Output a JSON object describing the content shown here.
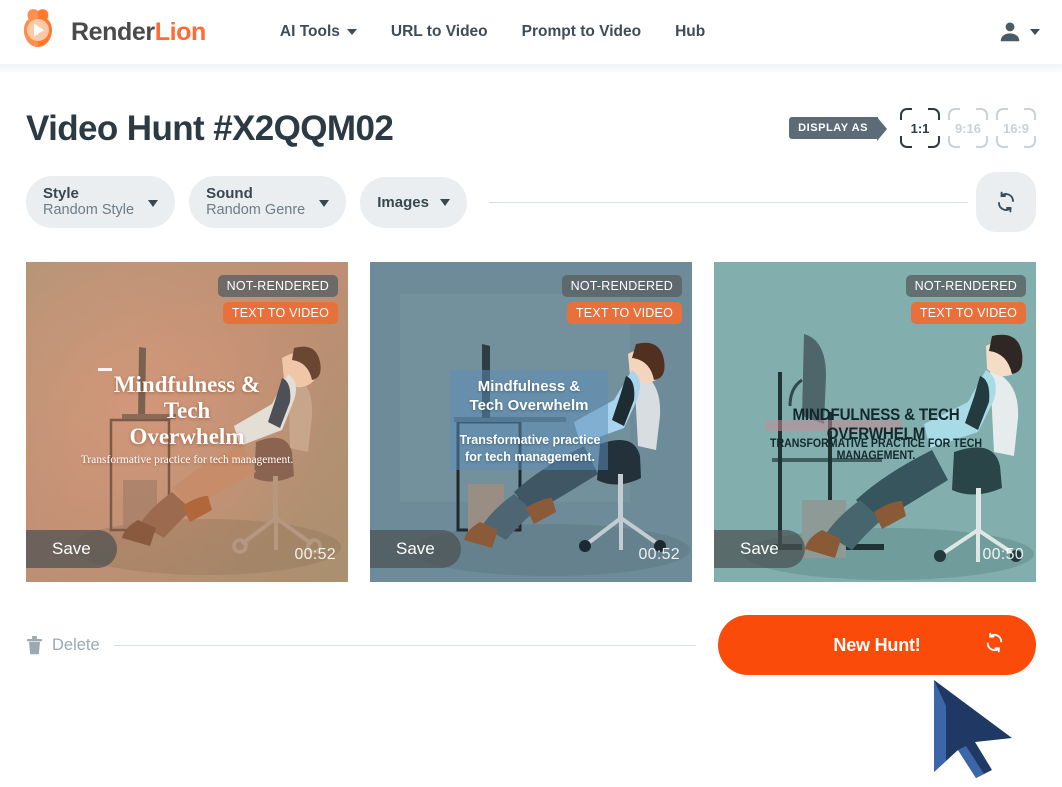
{
  "header": {
    "logo": {
      "icon": "lion-play-logo-icon",
      "text_primary": "Render",
      "text_secondary": "Lion"
    },
    "nav": [
      {
        "label": "AI Tools",
        "has_caret": true
      },
      {
        "label": "URL to Video",
        "has_caret": false
      },
      {
        "label": "Prompt to Video",
        "has_caret": false
      },
      {
        "label": "Hub",
        "has_caret": false
      }
    ],
    "account": {
      "icon": "user-account-icon",
      "has_caret": true
    }
  },
  "page": {
    "title": "Video Hunt #X2QQM02",
    "display_as": {
      "label": "DISPLAY AS",
      "options": [
        {
          "label": "1:1",
          "active": true
        },
        {
          "label": "9:16",
          "active": false
        },
        {
          "label": "16:9",
          "active": false
        }
      ]
    },
    "filters": [
      {
        "label": "Style",
        "value": "Random Style",
        "type": "two-line"
      },
      {
        "label": "Sound",
        "value": "Random Genre",
        "type": "two-line"
      },
      {
        "label": "Images",
        "value": "",
        "type": "single"
      }
    ],
    "refresh": {
      "icon": "refresh-sync-icon"
    }
  },
  "cards": [
    {
      "status_badge": "NOT-RENDERED",
      "type_badge": "TEXT TO VIDEO",
      "save_label": "Save",
      "duration": "00:52",
      "overlay_title": "Mindfulness &\nTech\nOverwhelm",
      "overlay_title_lines": [
        "Mindfulness &",
        "Tech",
        "Overwhelm"
      ],
      "overlay_subtitle": "Transformative practice for tech management.",
      "theme_color": "#b08a70"
    },
    {
      "status_badge": "NOT-RENDERED",
      "type_badge": "TEXT TO VIDEO",
      "save_label": "Save",
      "duration": "00:52",
      "overlay_title_lines": [
        "Mindfulness &",
        "Tech Overwhelm"
      ],
      "overlay_subtitle_lines": [
        "Transformative practice",
        "for tech management."
      ],
      "theme_color": "#6d8b99"
    },
    {
      "status_badge": "NOT-RENDERED",
      "type_badge": "TEXT TO VIDEO",
      "save_label": "Save",
      "duration": "00:50",
      "overlay_title": "MINDFULNESS & TECH OVERWHELM",
      "overlay_subtitle": "TRANSFORMATIVE PRACTICE FOR TECH MANAGEMENT.",
      "theme_color": "#82afae"
    }
  ],
  "bottom": {
    "delete_label": "Delete",
    "delete_icon": "trash-icon",
    "new_hunt_label": "New Hunt!",
    "new_hunt_icon": "refresh-sync-icon"
  },
  "colors": {
    "brand_orange": "#FF6B35",
    "cta_orange": "#FB4B0B",
    "badge_orange": "#e8703a",
    "dark_slate": "#2b3a43",
    "muted": "#9aa9b2",
    "pill_bg": "#eaeef0",
    "cursor_dark": "#1f3864",
    "cursor_light": "#3b66a8"
  }
}
